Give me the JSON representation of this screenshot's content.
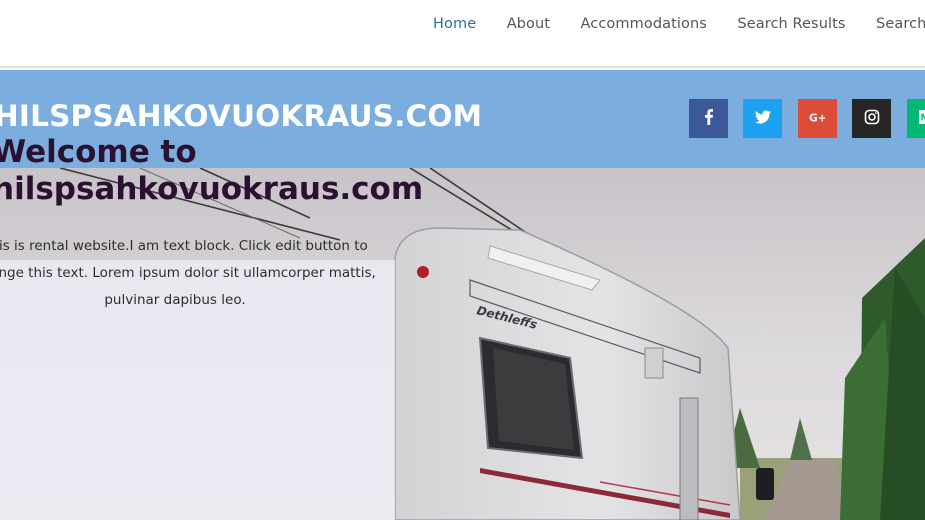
{
  "nav": {
    "items": [
      {
        "label": "Home",
        "active": true
      },
      {
        "label": "About",
        "active": false
      },
      {
        "label": "Accommodations",
        "active": false
      },
      {
        "label": "Search Results",
        "active": false
      },
      {
        "label": "Search Availability",
        "active": false
      }
    ]
  },
  "header": {
    "site_title": "HILSPSAHKOVUOKRAUS.COM",
    "background_color": "#7baedf"
  },
  "social": [
    {
      "name": "facebook-icon",
      "color": "#3b5998"
    },
    {
      "name": "twitter-icon",
      "color": "#1da1f2"
    },
    {
      "name": "google-plus-icon",
      "color": "#dd4b39"
    },
    {
      "name": "instagram-icon",
      "color": "#262626"
    },
    {
      "name": "medium-icon",
      "color": "#02b875"
    }
  ],
  "hero": {
    "title_line1": "Welcome to",
    "title_line2": "hilspsahkovuokraus.com",
    "text": "This is rental website.I am text block. Click edit button to change this text. Lorem ipsum dolor sit ullamcorper mattis, pulvinar dapibus leo.",
    "caravan_brand": "Dethleffs"
  }
}
